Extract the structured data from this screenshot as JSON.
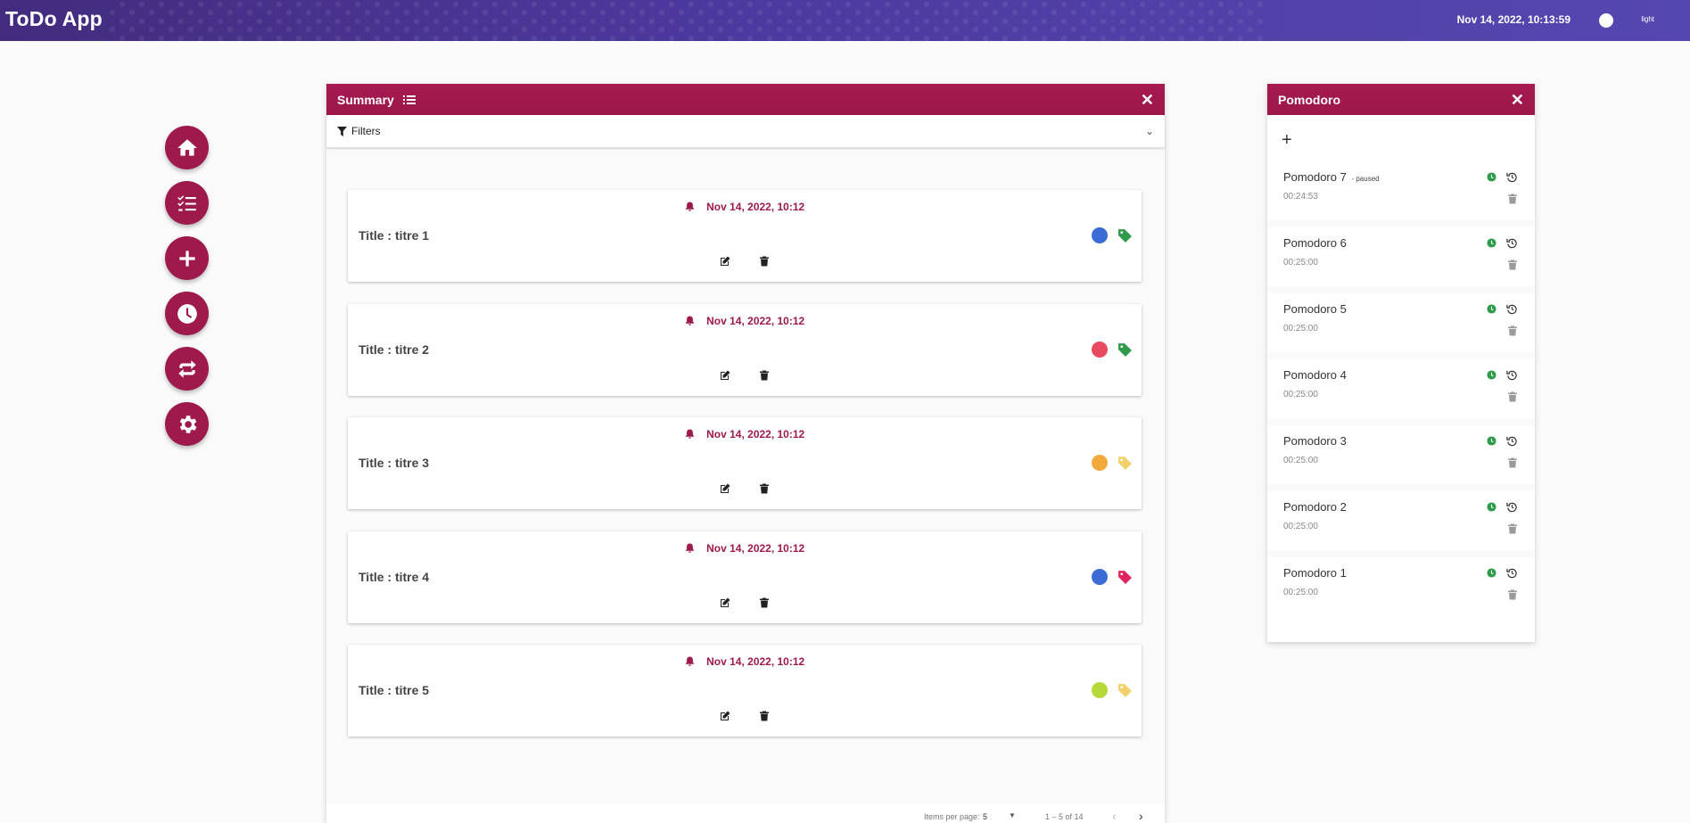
{
  "header": {
    "title": "ToDo App",
    "datetime": "Nov 14, 2022, 10:13:59",
    "theme_label": "light"
  },
  "nav": [
    "home-icon",
    "checklist-icon",
    "plus-icon",
    "clock-icon",
    "repeat-icon",
    "gear-icon"
  ],
  "summary": {
    "title": "Summary",
    "filters_label": "Filters",
    "tasks": [
      {
        "date": "Nov 14, 2022, 10:12",
        "title": "Title : titre 1",
        "color": "#3a6bd6",
        "tag_color": "#2e9a4a"
      },
      {
        "date": "Nov 14, 2022, 10:12",
        "title": "Title : titre 2",
        "color": "#e84a5f",
        "tag_color": "#2e9a4a"
      },
      {
        "date": "Nov 14, 2022, 10:12",
        "title": "Title : titre 3",
        "color": "#f0a93a",
        "tag_color": "#f2d06b"
      },
      {
        "date": "Nov 14, 2022, 10:12",
        "title": "Title : titre 4",
        "color": "#3a6bd6",
        "tag_color": "#e0245e"
      },
      {
        "date": "Nov 14, 2022, 10:12",
        "title": "Title : titre 5",
        "color": "#b6d93a",
        "tag_color": "#f2d06b"
      }
    ],
    "paginator": {
      "items_per_page_label": "Items per page:",
      "items_per_page": "5",
      "range": "1 – 5 of 14"
    }
  },
  "pomodoro": {
    "title": "Pomodoro",
    "items": [
      {
        "name": "Pomodoro 7",
        "status": "- paused",
        "time": "00:24:53"
      },
      {
        "name": "Pomodoro 6",
        "status": "",
        "time": "00:25:00"
      },
      {
        "name": "Pomodoro 5",
        "status": "",
        "time": "00:25:00"
      },
      {
        "name": "Pomodoro 4",
        "status": "",
        "time": "00:25:00"
      },
      {
        "name": "Pomodoro 3",
        "status": "",
        "time": "00:25:00"
      },
      {
        "name": "Pomodoro 2",
        "status": "",
        "time": "00:25:00"
      },
      {
        "name": "Pomodoro 1",
        "status": "",
        "time": "00:25:00"
      }
    ]
  },
  "colors": {
    "accent": "#9e1a4d",
    "green": "#2e9a4a"
  }
}
